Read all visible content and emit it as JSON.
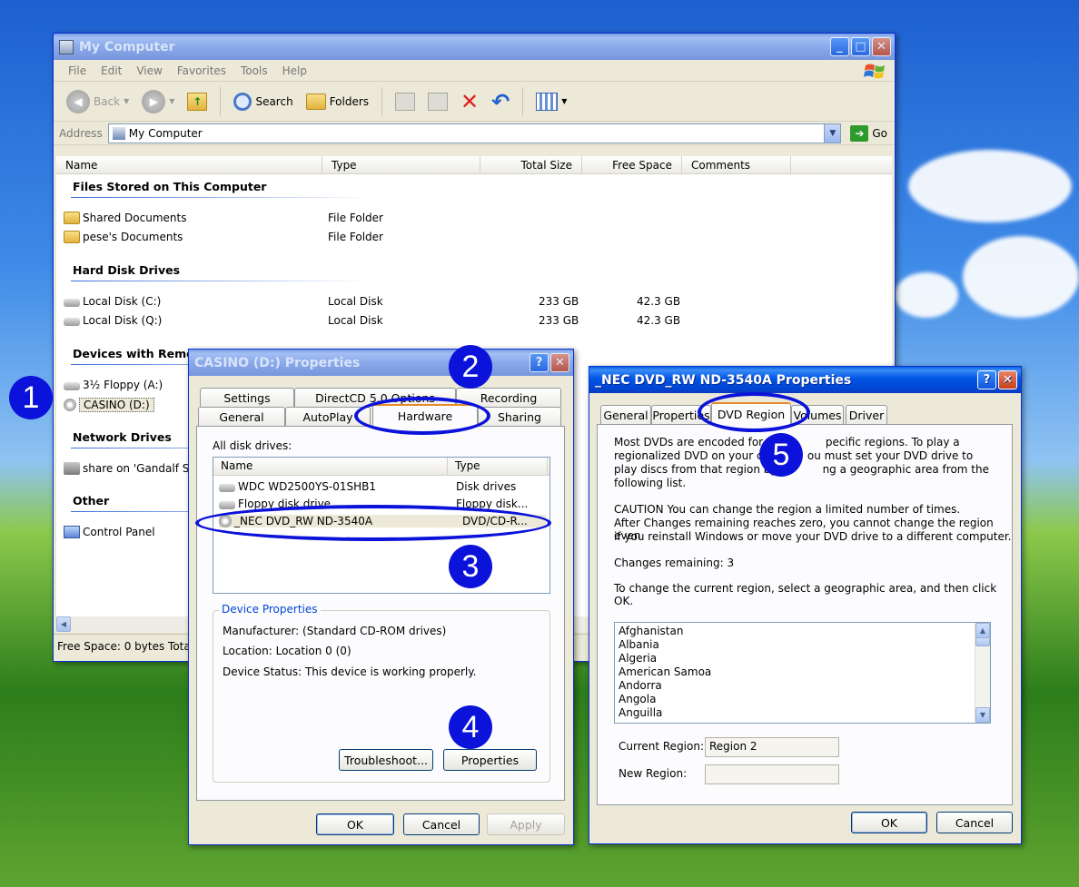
{
  "mycomputer": {
    "title": "My Computer",
    "menu": [
      "File",
      "Edit",
      "View",
      "Favorites",
      "Tools",
      "Help"
    ],
    "toolbar": {
      "back": "Back",
      "search": "Search",
      "folders": "Folders"
    },
    "address": {
      "label": "Address",
      "value": "My Computer",
      "go": "Go"
    },
    "columns": [
      "Name",
      "Type",
      "Total Size",
      "Free Space",
      "Comments"
    ],
    "groups": {
      "files": "Files Stored on This Computer",
      "hdd": "Hard Disk Drives",
      "removable": "Devices with Remov",
      "network": "Network Drives",
      "other": "Other"
    },
    "items": {
      "shared_docs": {
        "name": "Shared Documents",
        "type": "File Folder"
      },
      "pese_docs": {
        "name": "pese's Documents",
        "type": "File Folder"
      },
      "disk_c": {
        "name": "Local Disk (C:)",
        "type": "Local Disk",
        "total": "233 GB",
        "free": "42.3 GB"
      },
      "disk_q": {
        "name": "Local Disk (Q:)",
        "type": "Local Disk",
        "total": "233 GB",
        "free": "42.3 GB"
      },
      "floppy": {
        "name": "3½ Floppy (A:)"
      },
      "casino": {
        "name": "CASINO (D:)"
      },
      "share": {
        "name": "share on 'Gandalf Ser"
      },
      "control_panel": {
        "name": "Control Panel"
      }
    },
    "status": "Free Space: 0 bytes Tota"
  },
  "casino_dialog": {
    "title": "CASINO (D:) Properties",
    "help": "?",
    "tabs_row1": [
      "Settings",
      "DirectCD 5.0 Options",
      "Recording"
    ],
    "tabs_row2": [
      "General",
      "AutoPlay",
      "Hardware",
      "Sharing"
    ],
    "all_drives_label": "All disk drives:",
    "list_columns": [
      "Name",
      "Type"
    ],
    "drives": [
      {
        "name": "WDC WD2500YS-01SHB1",
        "type": "Disk drives"
      },
      {
        "name": "Floppy disk drive",
        "type": "Floppy disk..."
      },
      {
        "name": "_NEC DVD_RW ND-3540A",
        "type": "DVD/CD-R..."
      }
    ],
    "device_properties": {
      "legend": "Device Properties",
      "manufacturer": "Manufacturer: (Standard CD-ROM drives)",
      "location": "Location: Location 0 (0)",
      "status": "Device Status: This device is working properly."
    },
    "buttons": {
      "troubleshoot": "Troubleshoot...",
      "properties": "Properties",
      "ok": "OK",
      "cancel": "Cancel",
      "apply": "Apply"
    }
  },
  "nec_dialog": {
    "title": "_NEC DVD_RW ND-3540A Properties",
    "help": "?",
    "tabs": [
      "General",
      "Properties",
      "DVD Region",
      "Volumes",
      "Driver"
    ],
    "para1_l1": "Most DVDs are encoded for pl",
    "para1_l1b": "pecific regions. To play a",
    "para1_l2": "regionalized DVD on your co",
    "para1_l2b": "ou must set your DVD drive to",
    "para1_l3": "play discs from that region by s",
    "para1_l3b": "ng a geographic area from the",
    "para1_l4": "following list.",
    "caution_l1": "CAUTION   You can change the region a limited number of times.",
    "caution_l2": "After Changes remaining reaches zero, you cannot change the region even",
    "caution_l3": "if you reinstall Windows or move your DVD drive to a different computer.",
    "changes_remaining": "Changes remaining: 3",
    "instruction": "To change the current region, select a geographic area, and then click OK.",
    "countries": [
      "Afghanistan",
      "Albania",
      "Algeria",
      "American Samoa",
      "Andorra",
      "Angola",
      "Anguilla"
    ],
    "current_region_label": "Current Region:",
    "current_region_value": "Region 2",
    "new_region_label": "New Region:",
    "new_region_value": "",
    "buttons": {
      "ok": "OK",
      "cancel": "Cancel"
    }
  },
  "annotations": [
    "1",
    "2",
    "3",
    "4",
    "5"
  ],
  "colors": {
    "xp_blue": "#0055e5",
    "annotation_blue": "#0b12d9",
    "tab_highlight": "#e68b2c"
  }
}
